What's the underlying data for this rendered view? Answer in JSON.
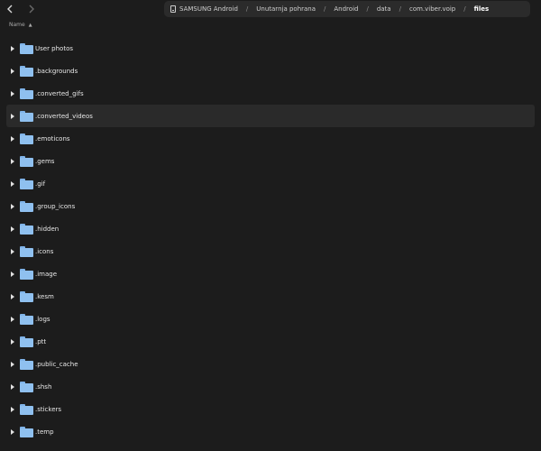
{
  "navigation": {
    "back_icon": "chevron-left-icon",
    "forward_icon": "chevron-right-icon"
  },
  "breadcrumb": {
    "device_icon": "phone-icon",
    "items": [
      "SAMSUNG Android",
      "Unutarnja pohrana",
      "Android",
      "data",
      "com.viber.voip",
      "files"
    ],
    "separator": "/"
  },
  "column_header": {
    "name_label": "Name",
    "sort_icon": "sort-up-icon"
  },
  "folders": [
    {
      "name": "User photos"
    },
    {
      "name": ".backgrounds"
    },
    {
      "name": ".converted_gifs"
    },
    {
      "name": ".converted_videos"
    },
    {
      "name": ".emoticons"
    },
    {
      "name": ".gems"
    },
    {
      "name": ".gif"
    },
    {
      "name": ".group_icons"
    },
    {
      "name": ".hidden"
    },
    {
      "name": ".icons"
    },
    {
      "name": ".image"
    },
    {
      "name": ".kesm"
    },
    {
      "name": ".logs"
    },
    {
      "name": ".ptt"
    },
    {
      "name": ".public_cache"
    },
    {
      "name": ".shsh"
    },
    {
      "name": ".stickers"
    },
    {
      "name": ".temp"
    }
  ],
  "selected_index": 3,
  "colors": {
    "background": "#1c1c1c",
    "breadcrumb_bg": "#2b2b2b",
    "selected_row_bg": "#2a2a2a",
    "folder_blue": "#8fc0ef"
  }
}
